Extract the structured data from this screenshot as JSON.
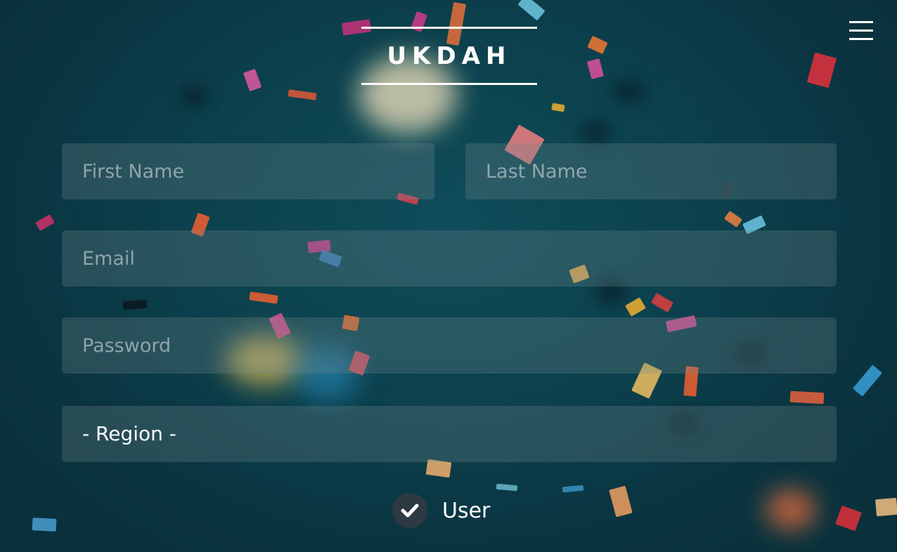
{
  "header": {
    "logo_text": "UKDAH",
    "menu_icon": "hamburger-menu-icon"
  },
  "form": {
    "first_name": {
      "placeholder": "First Name",
      "value": ""
    },
    "last_name": {
      "placeholder": "Last Name",
      "value": ""
    },
    "email": {
      "placeholder": "Email",
      "value": ""
    },
    "password": {
      "placeholder": "Password",
      "value": ""
    },
    "region": {
      "selected_label": "- Region -"
    },
    "user_checkbox": {
      "label": "User",
      "checked": true,
      "icon": "checkmark-icon"
    }
  },
  "colors": {
    "background": "#0b3f4b",
    "field_background": "rgba(120,140,145,0.28)",
    "text": "#ffffff",
    "checkbox_circle": "#2e3a42"
  }
}
